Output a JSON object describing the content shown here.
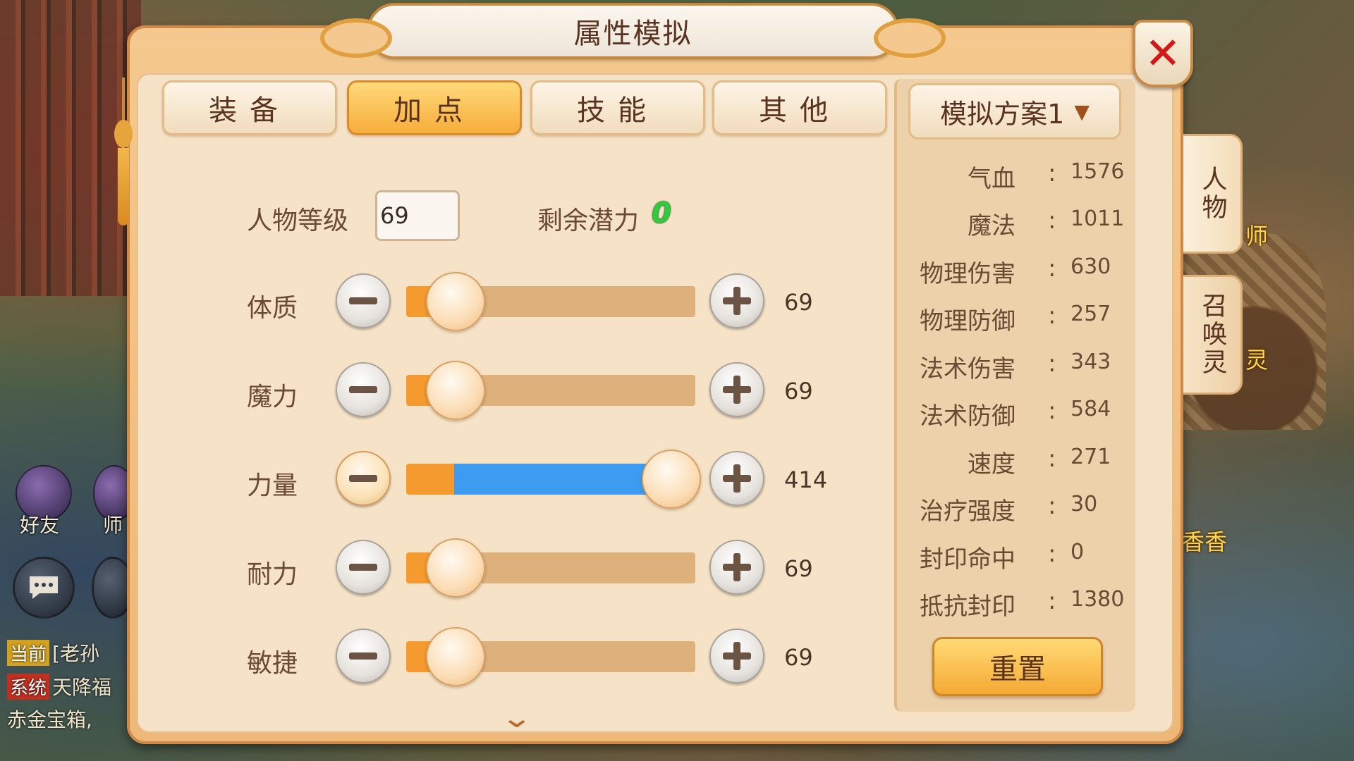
{
  "background": {
    "hud_friend_label": "好友",
    "hud_master_label": "师",
    "chat_lines": [
      {
        "tag": "当前",
        "tag_color": "#d4a020",
        "text": "[老孙"
      },
      {
        "tag": "系统",
        "tag_color": "#c03020",
        "text": "天降福"
      },
      {
        "tag": "",
        "tag_color": "",
        "text": "赤金宝箱,"
      }
    ],
    "right_labels": [
      "师",
      "灵",
      "香香"
    ]
  },
  "dialog": {
    "title": "属性模拟",
    "close_icon": "close-icon"
  },
  "tabs": [
    {
      "label": "装备",
      "active": false
    },
    {
      "label": "加点",
      "active": true
    },
    {
      "label": "技能",
      "active": false
    },
    {
      "label": "其他",
      "active": false
    }
  ],
  "level": {
    "label": "人物等级",
    "value": "69"
  },
  "potential": {
    "label": "剩余潜力",
    "value": "0"
  },
  "attributes": [
    {
      "label": "体质",
      "value": 69,
      "fraction": 0.0
    },
    {
      "label": "魔力",
      "value": 69,
      "fraction": 0.0
    },
    {
      "label": "力量",
      "value": 414,
      "fraction": 1.0
    },
    {
      "label": "耐力",
      "value": 69,
      "fraction": 0.0
    },
    {
      "label": "敏捷",
      "value": 69,
      "fraction": 0.0
    }
  ],
  "scheme": {
    "selected": "模拟方案1"
  },
  "stats": [
    {
      "label": "气血",
      "value": "1576"
    },
    {
      "label": "魔法",
      "value": "1011"
    },
    {
      "label": "物理伤害",
      "value": "630"
    },
    {
      "label": "物理防御",
      "value": "257"
    },
    {
      "label": "法术伤害",
      "value": "343"
    },
    {
      "label": "法术防御",
      "value": "584"
    },
    {
      "label": "速度",
      "value": "271"
    },
    {
      "label": "治疗强度",
      "value": "30"
    },
    {
      "label": "封印命中",
      "value": "0"
    },
    {
      "label": "抵抗封印",
      "value": "1380"
    }
  ],
  "reset_label": "重置",
  "side_tabs": [
    {
      "label": "人物",
      "active": true
    },
    {
      "label": "召唤灵",
      "active": false
    }
  ],
  "colors": {
    "accent_orange": "#f49a2e",
    "slider_blue": "#3d9cf0",
    "potential_green": "#2fcb3a",
    "close_red": "#d41818"
  }
}
